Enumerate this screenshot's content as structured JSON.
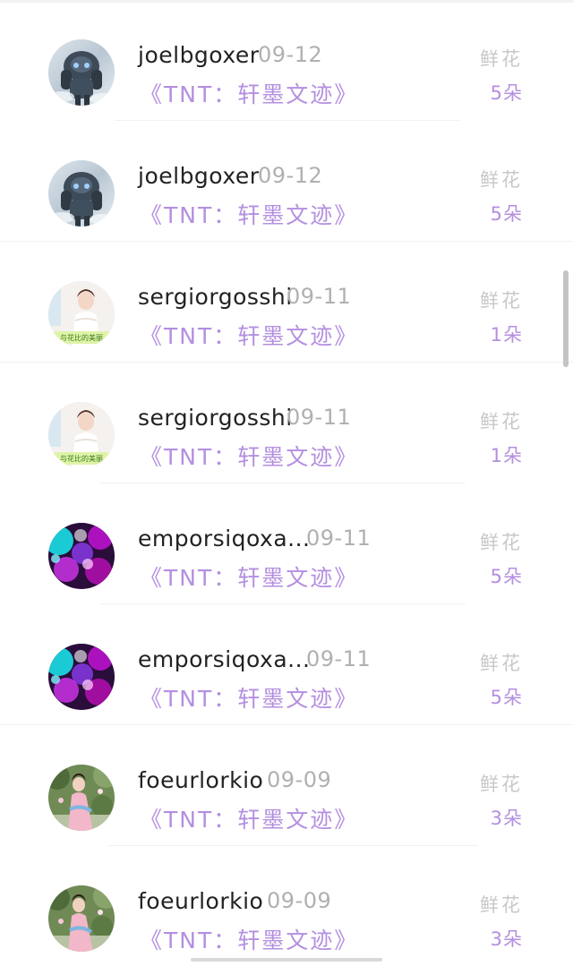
{
  "entries": [
    {
      "user": "joelbgoxer",
      "date": "09-12",
      "book": "《TNT：轩墨文迹》",
      "gift_label": "鲜花",
      "gift_count": "5朵",
      "avatar_icon": "robot-avatar-icon"
    },
    {
      "user": "joelbgoxer",
      "date": "09-12",
      "book": "《TNT：轩墨文迹》",
      "gift_label": "鲜花",
      "gift_count": "5朵",
      "avatar_icon": "robot-avatar-icon"
    },
    {
      "user": "sergiorgosshi",
      "date": "09-11",
      "book": "《TNT：轩墨文迹》",
      "gift_label": "鲜花",
      "gift_count": "1朵",
      "avatar_icon": "girl-portrait-avatar-icon",
      "avatar_caption": "与花比的美丽"
    },
    {
      "user": "sergiorgosshi",
      "date": "09-11",
      "book": "《TNT：轩墨文迹》",
      "gift_label": "鲜花",
      "gift_count": "1朵",
      "avatar_icon": "girl-portrait-avatar-icon",
      "avatar_caption": "与花比的美丽"
    },
    {
      "user": "emporsiqoxa...",
      "date": "09-11",
      "book": "《TNT：轩墨文迹》",
      "gift_label": "鲜花",
      "gift_count": "5朵",
      "avatar_icon": "bokeh-lights-avatar-icon"
    },
    {
      "user": "emporsiqoxa...",
      "date": "09-11",
      "book": "《TNT：轩墨文迹》",
      "gift_label": "鲜花",
      "gift_count": "5朵",
      "avatar_icon": "bokeh-lights-avatar-icon"
    },
    {
      "user": "foeurlorkio",
      "date": "09-09",
      "book": "《TNT：轩墨文迹》",
      "gift_label": "鲜花",
      "gift_count": "3朵",
      "avatar_icon": "garden-portrait-avatar-icon"
    },
    {
      "user": "foeurlorkio",
      "date": "09-09",
      "book": "《TNT：轩墨文迹》",
      "gift_label": "鲜花",
      "gift_count": "3朵",
      "avatar_icon": "garden-portrait-avatar-icon"
    }
  ],
  "colors": {
    "accent_purple": "#b48fe0",
    "username": "#222222",
    "muted": "#b0b0b0"
  }
}
